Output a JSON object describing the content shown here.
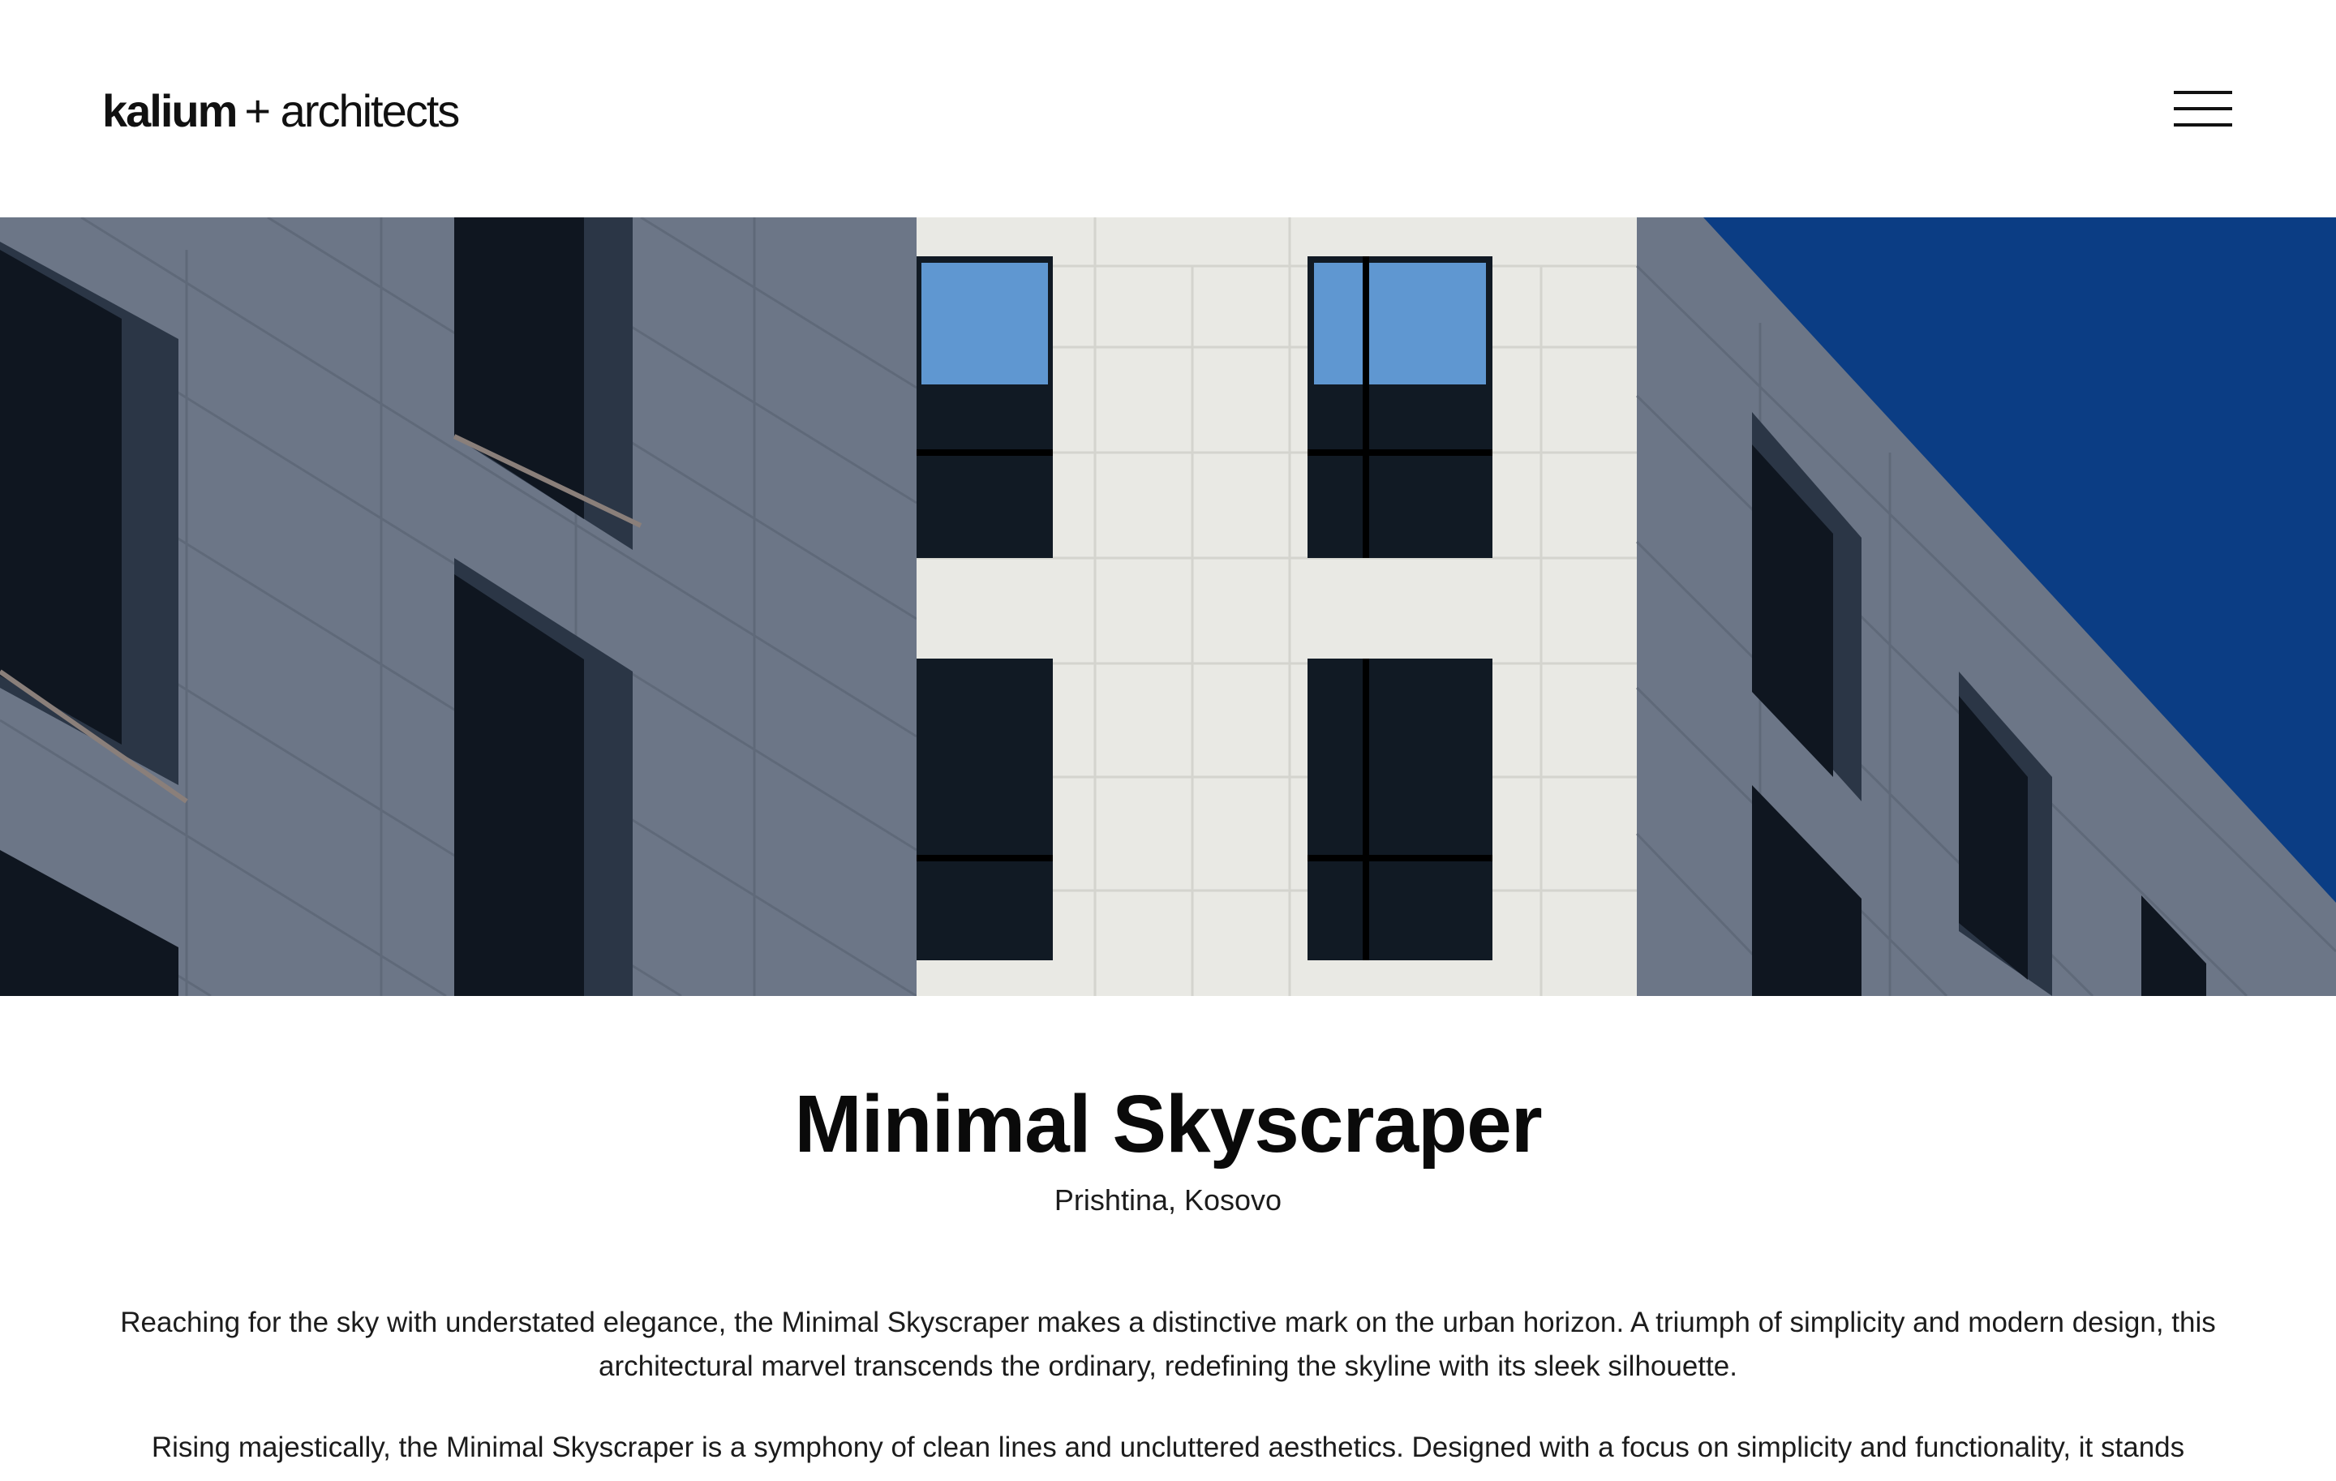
{
  "header": {
    "logo_brand": "kalium",
    "logo_rest": "+ architects",
    "menu_icon": "hamburger-menu-icon"
  },
  "hero": {
    "image_subject": "building-facade",
    "colors": {
      "sky": "#0b3d84",
      "grey_facade": "#6c7687",
      "white_facade": "#e9e9e4",
      "window_glass": "#121a24",
      "window_sky_reflection": "#5f97d1"
    }
  },
  "project": {
    "title": "Minimal Skyscraper",
    "location": "Prishtina, Kosovo",
    "paragraphs": [
      "Reaching for the sky with understated elegance, the Minimal Skyscraper makes a distinctive mark on the urban horizon. A triumph of simplicity and modern design, this architectural marvel transcends the ordinary, redefining the skyline with its sleek silhouette.",
      "Rising majestically, the Minimal Skyscraper is a symphony of clean lines and uncluttered aesthetics. Designed with a focus on simplicity and functionality, it stands"
    ]
  }
}
